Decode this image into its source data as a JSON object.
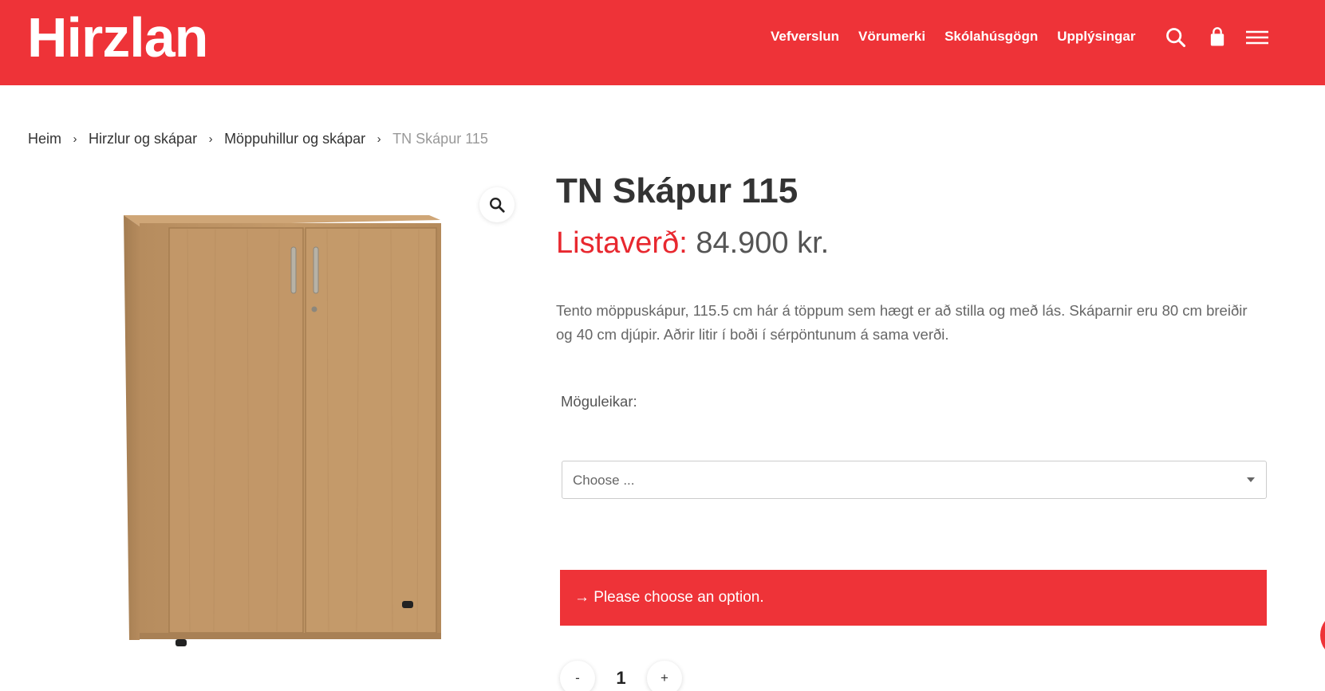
{
  "header": {
    "logo_text": "Hirzlan",
    "nav": [
      "Vefverslun",
      "Vörumerki",
      "Skólahúsgögn",
      "Upplýsingar"
    ],
    "icons": [
      "search-icon",
      "shopping-bag-icon",
      "menu-icon"
    ],
    "bg_color": "#ee3338"
  },
  "breadcrumb": {
    "items": [
      "Heim",
      "Hirzlur og skápar",
      "Möppuhillur og skápar"
    ],
    "current": "TN Skápur 115",
    "separator": "›"
  },
  "product": {
    "title": "TN Skápur 115",
    "price_label": "Listaverð:",
    "price_value": "84.900 kr.",
    "description": "Tento möppuskápur, 115.5 cm hár á töppum sem hægt er að stilla og með lás. Skáparnir eru 80 cm breiðir og 40 cm djúpir. Aðrir litir í boði í sérpöntunum á sama verði.",
    "options_label": "Möguleikar:",
    "select_value": "Choose ...",
    "notice": "→ Please choose an option.",
    "quantity": "1",
    "qty_minus": "-",
    "qty_plus": "+"
  },
  "colors": {
    "accent": "#ee3338",
    "price_label": "#e8282f"
  }
}
